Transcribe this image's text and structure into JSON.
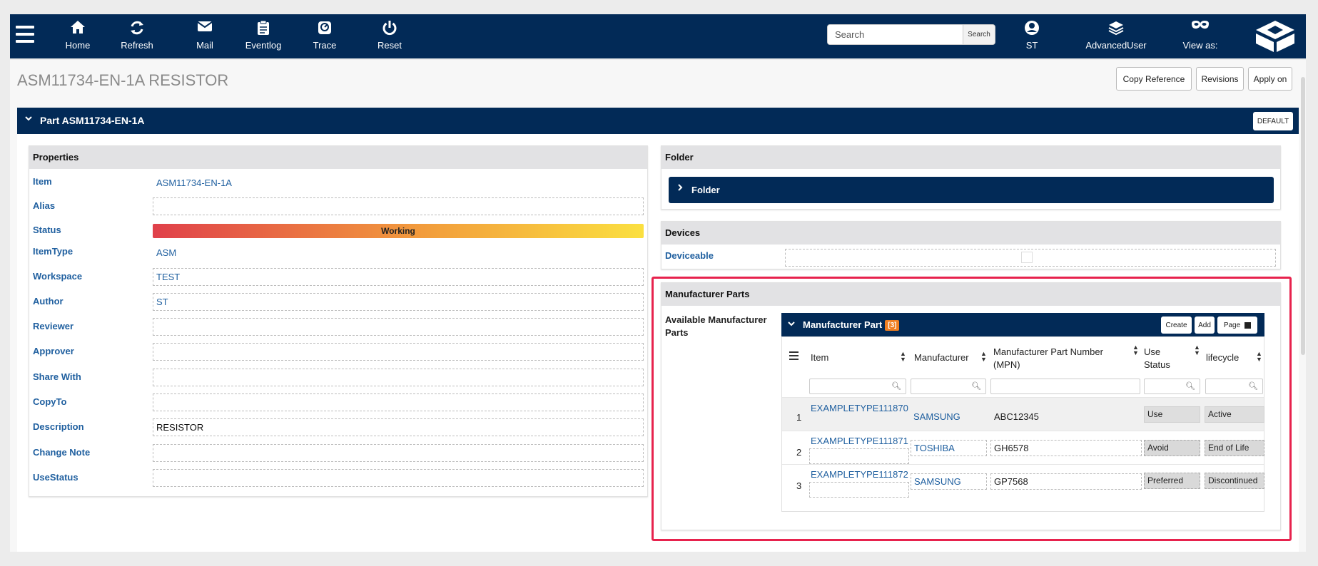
{
  "nav": {
    "items": [
      {
        "label": "Home",
        "icon": "home-icon"
      },
      {
        "label": "Refresh",
        "icon": "refresh-icon"
      },
      {
        "label": "Mail",
        "icon": "mail-icon"
      },
      {
        "label": "Eventlog",
        "icon": "clipboard-icon"
      },
      {
        "label": "Trace",
        "icon": "trace-icon"
      },
      {
        "label": "Reset",
        "icon": "power-icon"
      }
    ],
    "search_placeholder": "Search",
    "search_button": "Search",
    "user": "ST",
    "role": "AdvancedUser",
    "view_as": "View as:"
  },
  "page": {
    "title": "ASM11734-EN-1A RESISTOR",
    "buttons": {
      "copy_reference": "Copy Reference",
      "revisions": "Revisions",
      "apply_on": "Apply on"
    }
  },
  "part": {
    "header": "Part ASM11734-EN-1A",
    "default_button": "DEFAULT"
  },
  "properties": {
    "title": "Properties",
    "rows": [
      {
        "label": "Item",
        "value": "ASM11734-EN-1A"
      },
      {
        "label": "Alias",
        "value": ""
      },
      {
        "label": "Status",
        "value": "Working"
      },
      {
        "label": "ItemType",
        "value": "ASM"
      },
      {
        "label": "Workspace",
        "value": "TEST"
      },
      {
        "label": "Author",
        "value": "ST"
      },
      {
        "label": "Reviewer",
        "value": ""
      },
      {
        "label": "Approver",
        "value": ""
      },
      {
        "label": "Share With",
        "value": ""
      },
      {
        "label": "CopyTo",
        "value": ""
      },
      {
        "label": "Description",
        "value": "RESISTOR"
      },
      {
        "label": "Change Note",
        "value": ""
      },
      {
        "label": "UseStatus",
        "value": ""
      }
    ]
  },
  "folder": {
    "title": "Folder",
    "bar_label": "Folder"
  },
  "devices": {
    "title": "Devices",
    "label": "Deviceable"
  },
  "mfr": {
    "title": "Manufacturer Parts",
    "available_label": "Available Manufacturer Parts",
    "grid_title": "Manufacturer Part",
    "count": "[3]",
    "buttons": {
      "create": "Create",
      "add": "Add",
      "page": "Page"
    },
    "columns": {
      "item": "Item",
      "manufacturer": "Manufacturer",
      "mpn": "Manufacturer Part Number (MPN)",
      "use_status": "Use Status",
      "lifecycle": "lifecycle"
    },
    "rows": [
      {
        "num": "1",
        "item": "EXAMPLETYPE111870",
        "manufacturer": "SAMSUNG",
        "mpn": "ABC12345",
        "use_status": "Use",
        "lifecycle": "Active"
      },
      {
        "num": "2",
        "item": "EXAMPLETYPE111871",
        "manufacturer": "TOSHIBA",
        "mpn": "GH6578",
        "use_status": "Avoid",
        "lifecycle": "End of Life"
      },
      {
        "num": "3",
        "item": "EXAMPLETYPE111872",
        "manufacturer": "SAMSUNG",
        "mpn": "GP7568",
        "use_status": "Preferred",
        "lifecycle": "Discontinued"
      }
    ]
  },
  "colors": {
    "navy": "#022a57",
    "link": "#1f5f9f",
    "highlight": "#e7224d",
    "badge": "#f07f22"
  }
}
